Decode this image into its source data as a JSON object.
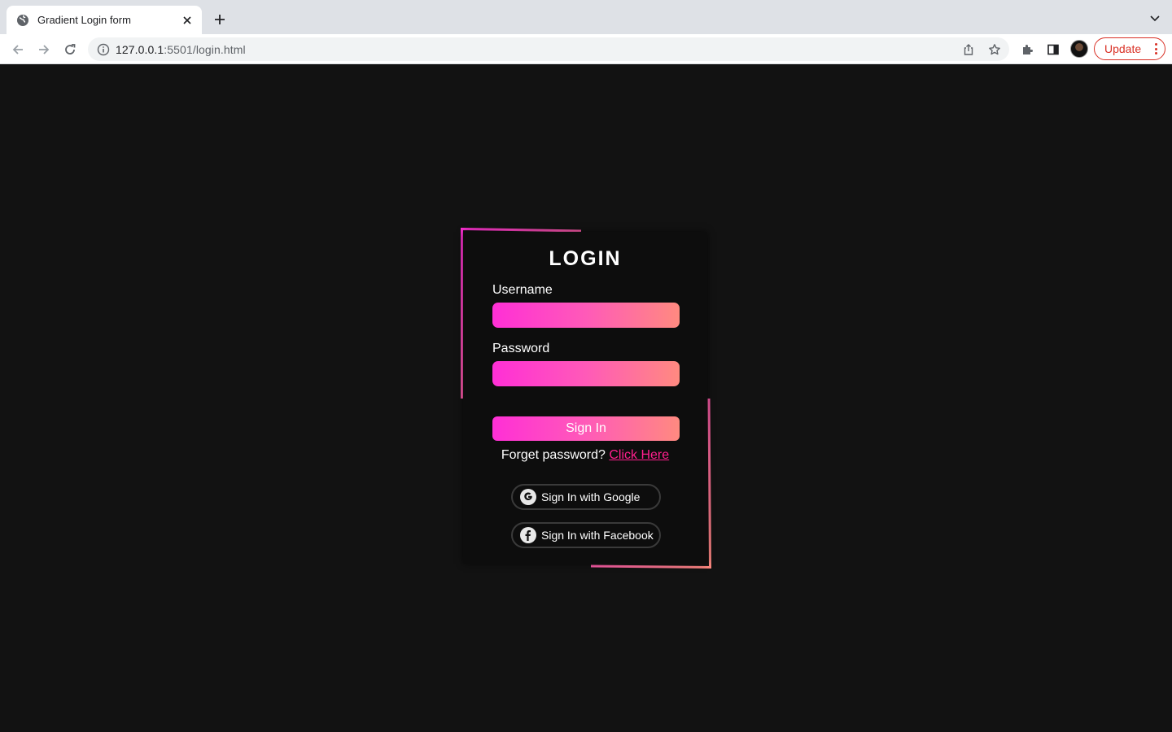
{
  "browser": {
    "tab_title": "Gradient Login form",
    "url_host": "127.0.0.1",
    "url_rest": ":5501/login.html",
    "update_label": "Update"
  },
  "page": {
    "title": "LOGIN",
    "username_label": "Username",
    "password_label": "Password",
    "signin_label": "Sign In",
    "forgot_text": "Forget password?",
    "forgot_link": "Click Here",
    "google_label": "Sign In with Google",
    "facebook_label": "Sign In with Facebook",
    "google_icon": "google-icon",
    "facebook_icon": "facebook-icon"
  },
  "colors": {
    "background": "#121212",
    "gradient_start": "#ff2fd6",
    "gradient_end": "#ff8a80",
    "link": "#ff1f8e",
    "update_red": "#d93025"
  }
}
